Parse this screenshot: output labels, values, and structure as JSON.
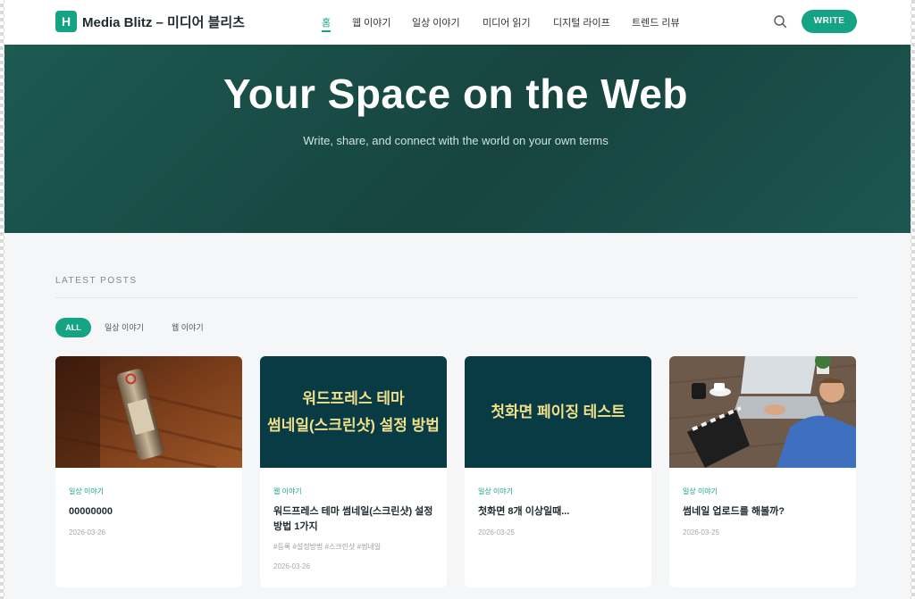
{
  "header": {
    "logo_letter": "H",
    "site_title": "Media Blitz – 미디어 블리츠",
    "nav": [
      "홈",
      "웹 이야기",
      "일상 이야기",
      "미디어 읽기",
      "디지털 라이프",
      "트렌드 리뷰"
    ],
    "write_label": "WRITE"
  },
  "hero": {
    "title": "Your Space on the Web",
    "subtitle": "Write, share, and connect with the world on your own terms"
  },
  "latest": {
    "label": "LATEST POSTS",
    "filters": [
      "ALL",
      "일상 이야기",
      "웹 이야기"
    ]
  },
  "cards": [
    {
      "category": "일상 이야기",
      "title": "00000000",
      "date": "2026-03-26"
    },
    {
      "thumb_text": "워드프레스 테마\n썸네일(스크린샷) 설정 방법",
      "category": "웹 이야기",
      "title": "워드프레스 테마 썸네일(스크린샷) 설정 방법 1가지",
      "tags": "#등록 #설정방법 #스크린샷 #썸네일",
      "date": "2026-03-26"
    },
    {
      "thumb_text": "첫화면 페이징 테스트",
      "category": "일상 이야기",
      "title": "첫화면 8개 이상일때...",
      "date": "2026-03-25"
    },
    {
      "category": "일상 이야기",
      "title": "썸네일 업로드를 해볼까?",
      "date": "2026-03-25"
    }
  ],
  "colors": {
    "accent": "#14a383",
    "hero": "#17443f",
    "thumb_dark": "#083b44"
  }
}
